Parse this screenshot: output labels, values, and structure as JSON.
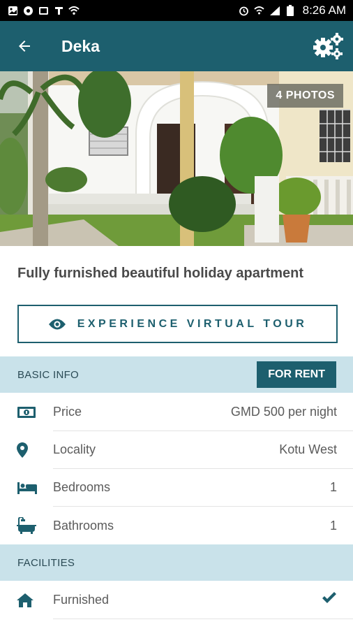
{
  "status_bar": {
    "time": "8:26 AM",
    "left_icons": [
      "photo-icon",
      "chrome-icon",
      "gallery-icon",
      "text-icon",
      "wifi-icon"
    ],
    "right_icons": [
      "alarm-icon",
      "wifi-calling-icon",
      "signal-icon",
      "battery-icon"
    ]
  },
  "app_bar": {
    "title": "Deka",
    "background": "#1d5f6e"
  },
  "hero": {
    "photo_count_label": "4 PHOTOS"
  },
  "listing": {
    "title": "Fully furnished beautiful holiday apartment",
    "tour_button_label": "EXPERIENCE VIRTUAL TOUR"
  },
  "basic_info": {
    "title": "BASIC INFO",
    "badge": "FOR RENT",
    "rows": [
      {
        "label": "Price",
        "value": "GMD 500 per night",
        "icon": "money-icon"
      },
      {
        "label": "Locality",
        "value": "Kotu West",
        "icon": "location-pin-icon"
      },
      {
        "label": "Bedrooms",
        "value": "1",
        "icon": "bed-icon"
      },
      {
        "label": "Bathrooms",
        "value": "1",
        "icon": "bathtub-icon"
      }
    ]
  },
  "facilities": {
    "title": "FACILITIES",
    "rows": [
      {
        "label": "Furnished",
        "icon": "home-icon",
        "checked": true
      }
    ]
  },
  "colors": {
    "accent": "#1d5f6e",
    "section_bg": "#c9e2ea"
  }
}
